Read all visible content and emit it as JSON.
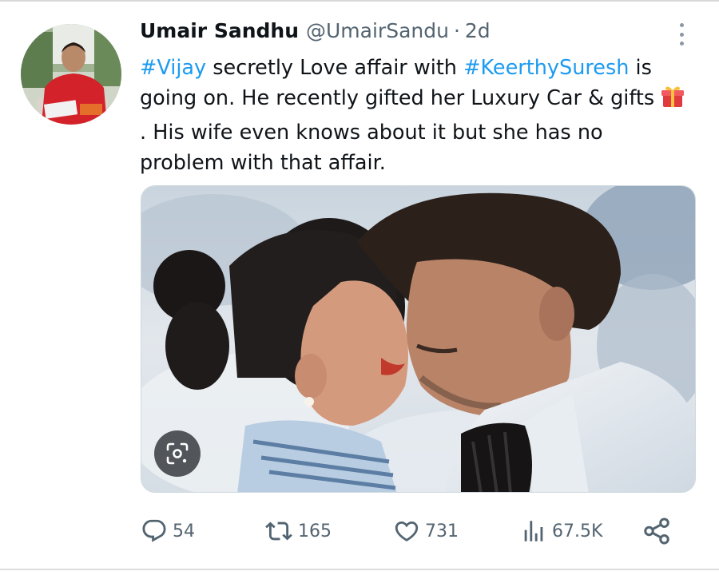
{
  "author": {
    "display_name": "Umair Sandhu",
    "handle": "@UmairSandu",
    "separator": "·",
    "time": "2d"
  },
  "tweet": {
    "segments": [
      {
        "type": "hashtag",
        "text": "#Vijay"
      },
      {
        "type": "text",
        "text": " secretly Love affair with "
      },
      {
        "type": "hashtag",
        "text": "#KeerthySuresh"
      },
      {
        "type": "text",
        "text": " is going on. He recently gifted her Luxury Car & gifts "
      },
      {
        "type": "emoji",
        "text": "🎁"
      },
      {
        "type": "text",
        "text": ". His wife even knows about it but she has no problem with that affair."
      }
    ]
  },
  "icons": {
    "more": "more-vertical-icon",
    "gift": "gift-icon",
    "lens": "google-lens-icon",
    "reply": "reply-icon",
    "retweet": "retweet-icon",
    "like": "heart-icon",
    "views": "views-icon",
    "share": "share-icon"
  },
  "metrics": {
    "replies": "54",
    "retweets": "165",
    "likes": "731",
    "views": "67.5K"
  },
  "colors": {
    "hashtag": "#1d9bf0",
    "secondary_text": "#536471",
    "primary_text": "#0f1419"
  }
}
